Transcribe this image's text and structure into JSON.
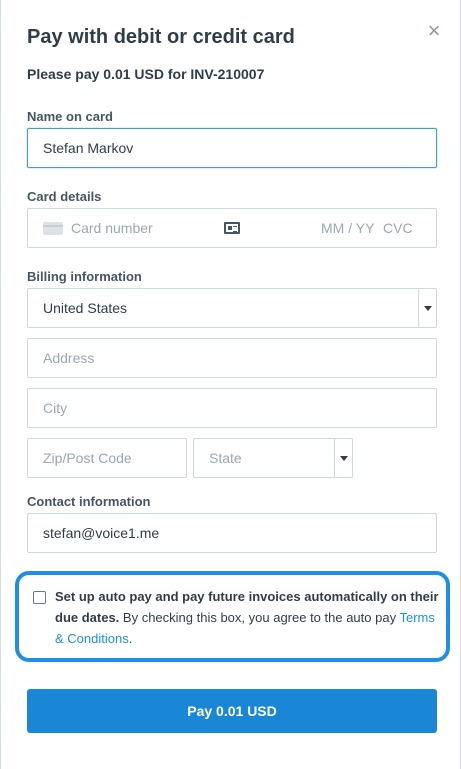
{
  "modal": {
    "title": "Pay with debit or credit card",
    "close_icon": "×",
    "subtitle": "Please pay 0.01 USD for INV-210007"
  },
  "name_on_card": {
    "label": "Name on card",
    "value": "Stefan Markov"
  },
  "card_details": {
    "label": "Card details",
    "card_number_placeholder": "Card number",
    "expiry_placeholder": "MM / YY",
    "cvc_placeholder": "CVC",
    "icons": [
      "credit-card-icon",
      "id-card-icon"
    ]
  },
  "billing": {
    "label": "Billing information",
    "country": "United States",
    "address_placeholder": "Address",
    "city_placeholder": "City",
    "zip_placeholder": "Zip/Post Code",
    "state_placeholder": "State"
  },
  "contact": {
    "label": "Contact information",
    "email": "stefan@voice1.me"
  },
  "autopay": {
    "checked": false,
    "bold_text": "Set up auto pay and pay future invoices automatically on their due dates.",
    "text": " By checking this box, you agree to the auto pay ",
    "link": "Terms & Conditions",
    "end": "."
  },
  "pay_button": "Pay 0.01 USD",
  "colors": {
    "accent": "#1a87d6",
    "highlight_border": "#1f8fe3",
    "focus_border": "#3a9fd6"
  }
}
